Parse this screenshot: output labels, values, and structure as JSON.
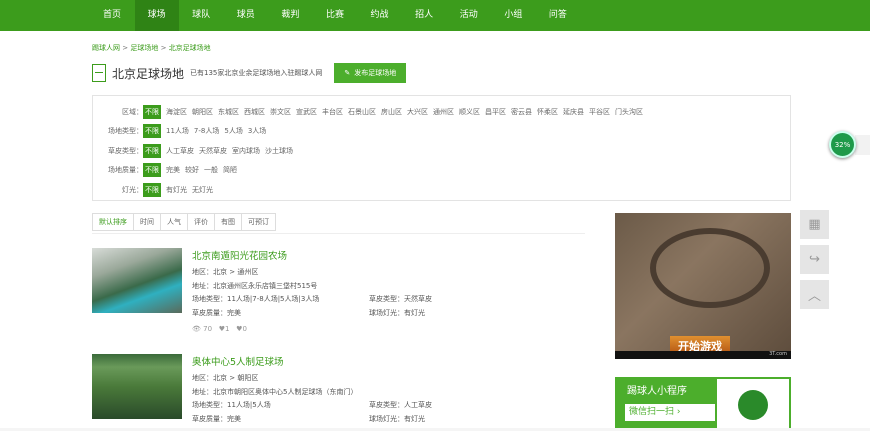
{
  "nav": {
    "items": [
      "首页",
      "球场",
      "球队",
      "球员",
      "裁判",
      "比赛",
      "约战",
      "招人",
      "活动",
      "小组",
      "问答"
    ],
    "active": 1
  },
  "breadcrumb": {
    "home": "踢球人网",
    "sep": ">",
    "level2": "足球场地",
    "current": "北京足球场地"
  },
  "header": {
    "title": "北京足球场地",
    "subtitle": "已有135家北京业余足球场地入驻踢球人网",
    "publish_button": "发布足球场地"
  },
  "filters": [
    {
      "label": "区域：",
      "options": [
        "不限",
        "海淀区",
        "朝阳区",
        "东城区",
        "西城区",
        "崇文区",
        "宣武区",
        "丰台区",
        "石景山区",
        "房山区",
        "大兴区",
        "通州区",
        "顺义区",
        "昌平区",
        "密云县",
        "怀柔区",
        "延庆县",
        "平谷区",
        "门头沟区"
      ]
    },
    {
      "label": "场地类型：",
      "options": [
        "不限",
        "11人场",
        "7-8人场",
        "5人场",
        "3人场"
      ]
    },
    {
      "label": "草皮类型：",
      "options": [
        "不限",
        "人工草皮",
        "天然草皮",
        "室内球场",
        "沙土球场"
      ]
    },
    {
      "label": "场地质量：",
      "options": [
        "不限",
        "完美",
        "较好",
        "一般",
        "简陋"
      ]
    },
    {
      "label": "灯光：",
      "options": [
        "不限",
        "有灯光",
        "无灯光"
      ]
    }
  ],
  "sort_tabs": [
    "默认排序",
    "时间",
    "人气",
    "评价",
    "有图",
    "可预订"
  ],
  "venues": [
    {
      "name": "北京南遁阳光花园农场",
      "region": "地区：北京 > 通州区",
      "address": "地址：北京通州区永乐店镇三垡村515号",
      "type": "场地类型：11人场|7-8人场|5人场|3人场",
      "turf": "草皮类型：天然草皮",
      "quality": "草皮质量：完美",
      "light": "球场灯光：有灯光",
      "views": "70",
      "likes": "1",
      "comments": "0"
    },
    {
      "name": "奥体中心5人制足球场",
      "region": "地区：北京 > 朝阳区",
      "address": "地址：北京市朝阳区奥体中心5人制足球场（东南门）",
      "type": "场地类型：11人场|5人场",
      "turf": "草皮类型：人工草皮",
      "quality": "草皮质量：完美",
      "light": "球场灯光：有灯光"
    }
  ],
  "ad": {
    "button": "开始游戏",
    "domain": "3T.com"
  },
  "miniprogram": {
    "title": "踢球人小程序",
    "scan": "微信扫一扫"
  },
  "progress": {
    "label": "32%",
    "value": 32
  }
}
